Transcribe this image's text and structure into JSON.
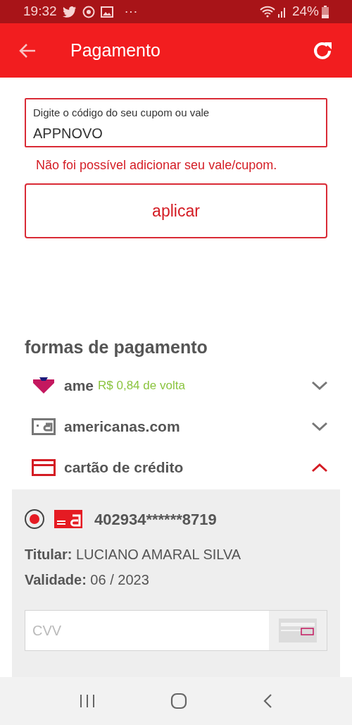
{
  "status_bar": {
    "time": "19:32",
    "more": "···",
    "battery": "24%"
  },
  "app_bar": {
    "title": "Pagamento"
  },
  "coupon": {
    "label": "Digite o código do seu cupom ou vale",
    "value": "APPNOVO",
    "error": "Não foi possível adicionar seu vale/cupom.",
    "button": "aplicar"
  },
  "payment": {
    "heading": "formas de pagamento",
    "methods": [
      {
        "kind": "ame",
        "label": "ame",
        "cashback": "R$ 0,84 de volta",
        "expanded": false
      },
      {
        "kind": "giftcard",
        "label": "americanas.com",
        "expanded": false
      },
      {
        "kind": "card",
        "label": "cartão de crédito",
        "expanded": true
      }
    ],
    "card": {
      "selected": true,
      "number": "402934******8719",
      "holder_label": "Titular:",
      "holder": "LUCIANO AMARAL SILVA",
      "expiry_label": "Validade:",
      "expiry": "06 / 2023",
      "cvv_placeholder": "CVV"
    }
  }
}
